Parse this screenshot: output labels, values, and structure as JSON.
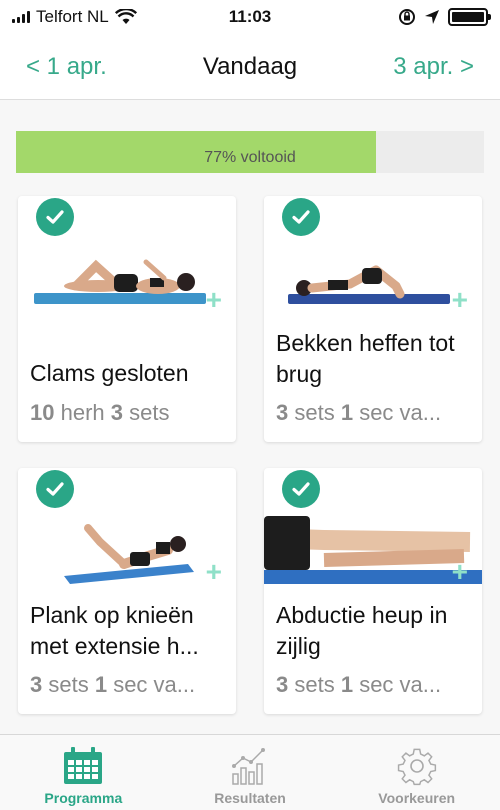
{
  "status_bar": {
    "carrier": "Telfort NL",
    "time": "11:03"
  },
  "nav": {
    "prev_label": "< 1 apr.",
    "title": "Vandaag",
    "next_label": "3 apr. >"
  },
  "progress": {
    "label": "77% voltooid",
    "value_percent": 77,
    "color": "#a3d86a"
  },
  "accent_color": "#2aa687",
  "exercises": [
    {
      "title": "Clams gesloten",
      "meta_parts": [
        [
          "10",
          " herh "
        ],
        [
          "3",
          " sets"
        ]
      ],
      "completed": true,
      "icon": "check-icon"
    },
    {
      "title": "Bekken heffen tot brug",
      "meta_parts": [
        [
          "3",
          " sets "
        ],
        [
          "1",
          " sec va..."
        ]
      ],
      "completed": true,
      "icon": "check-icon"
    },
    {
      "title": "Plank op knieën met extensie h...",
      "meta_parts": [
        [
          "3",
          " sets "
        ],
        [
          "1",
          " sec va..."
        ]
      ],
      "completed": true,
      "icon": "check-icon"
    },
    {
      "title": "Abductie heup in zijlig",
      "meta_parts": [
        [
          "3",
          " sets "
        ],
        [
          "1",
          " sec va..."
        ]
      ],
      "completed": true,
      "icon": "check-icon"
    }
  ],
  "tabs": [
    {
      "label": "Programma",
      "icon": "calendar-icon",
      "active": true
    },
    {
      "label": "Resultaten",
      "icon": "chart-icon",
      "active": false
    },
    {
      "label": "Voorkeuren",
      "icon": "gear-icon",
      "active": false
    }
  ]
}
